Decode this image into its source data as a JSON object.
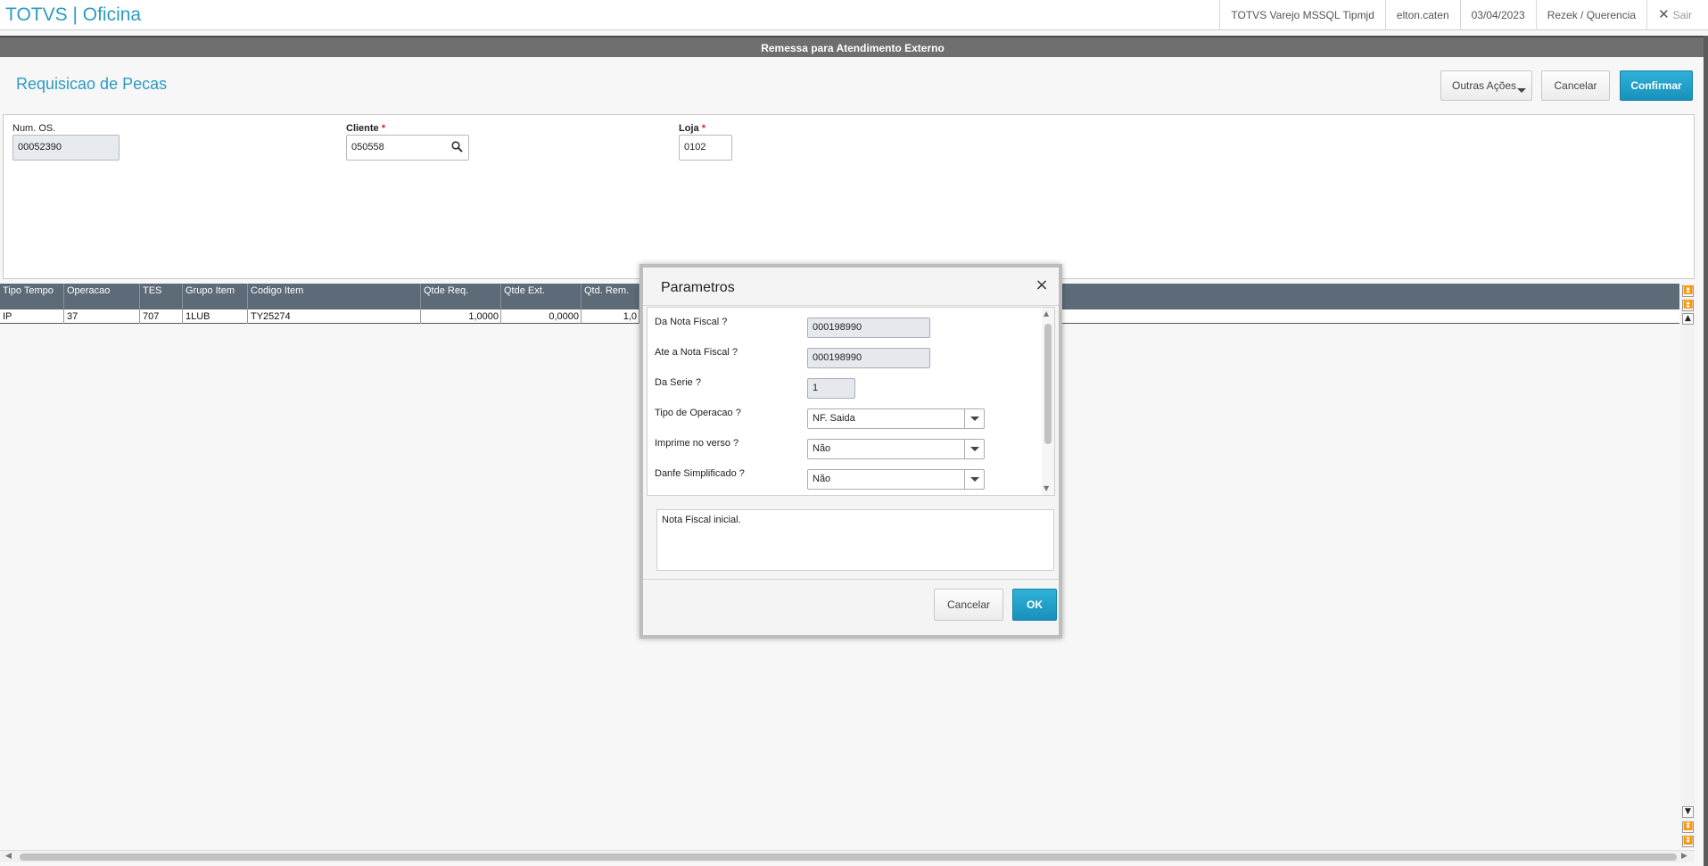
{
  "app": {
    "title": "TOTVS | Oficina",
    "environment": "TOTVS Varejo MSSQL Tipmjd",
    "user": "elton.caten",
    "date": "03/04/2023",
    "branch": "Rezek / Querencia",
    "logout_label": "Sair"
  },
  "window": {
    "caption": "Remessa para Atendimento Externo"
  },
  "header": {
    "title": "Requisicao de Pecas",
    "outras_acoes_label": "Outras Ações",
    "cancelar_label": "Cancelar",
    "confirmar_label": "Confirmar"
  },
  "form": {
    "num_os": {
      "label": "Num. OS.",
      "value": "00052390"
    },
    "cliente": {
      "label": "Cliente",
      "required_mark": "*",
      "value": "050558"
    },
    "loja": {
      "label": "Loja",
      "required_mark": "*",
      "value": "0102"
    }
  },
  "grid": {
    "columns": [
      "Tipo Tempo",
      "Operacao",
      "TES",
      "Grupo Item",
      "Codigo Item",
      "Qtde Req.",
      "Qtde Ext.",
      "Qtd. Rem."
    ],
    "rows": [
      [
        "IP",
        "37",
        "707",
        "1LUB",
        "TY25274",
        "1,0000",
        "0,0000",
        "1,0"
      ]
    ]
  },
  "dialog": {
    "title": "Parametros",
    "close_label": "×",
    "params": [
      {
        "label": "Da Nota Fiscal ?",
        "value": "000198990"
      },
      {
        "label": "Ate a Nota Fiscal ?",
        "value": "000198990"
      },
      {
        "label": "Da Serie ?",
        "value": "1"
      },
      {
        "label": "Tipo de Operacao ?",
        "value": "NF. Saida"
      },
      {
        "label": "Imprime no verso ?",
        "value": "Não"
      },
      {
        "label": "Danfe Simplificado ?",
        "value": "Não"
      }
    ],
    "help_text": "Nota Fiscal inicial.",
    "cancelar_label": "Cancelar",
    "ok_label": "OK"
  },
  "colors": {
    "accent": "#2a9bc2",
    "primary_button": "#1f9cc5",
    "grid_header": "#5d6b78",
    "caption_bar": "#6f6f6f"
  }
}
